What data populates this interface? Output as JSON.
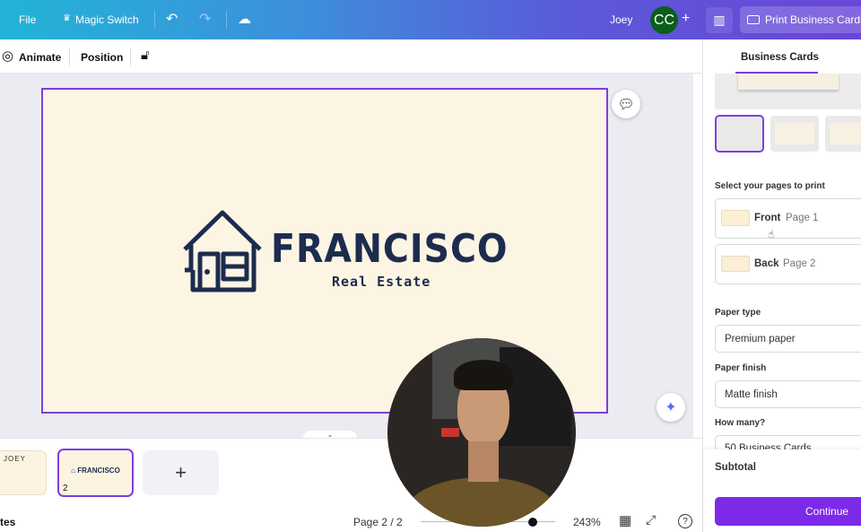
{
  "topbar": {
    "file": "File",
    "magic_switch": "Magic Switch",
    "user": "Joey",
    "avatar_initials": "CC",
    "print_button": "Print Business Cards"
  },
  "toolbar": {
    "animate": "Animate",
    "position": "Position"
  },
  "design": {
    "brand": "FRANCISCO",
    "tagline": "Real Estate"
  },
  "pages": {
    "thumb1_text": "JOEY",
    "thumb2_text": "FRANCISCO",
    "thumb2_number": "2",
    "add_page": "+"
  },
  "bottombar": {
    "notes": "tes",
    "page_indicator": "Page 2 / 2",
    "zoom": "243%",
    "zoom_level_percent": 243
  },
  "panel": {
    "tab": "Business Cards",
    "select_pages_label": "Select your pages to print",
    "pages": [
      {
        "side": "Front",
        "page": "Page 1"
      },
      {
        "side": "Back",
        "page": "Page 2"
      }
    ],
    "paper_type_label": "Paper type",
    "paper_type": "Premium paper",
    "paper_finish_label": "Paper finish",
    "paper_finish": "Matte finish",
    "quantity_label": "How many?",
    "quantity": "50 Business Cards",
    "subtotal_label": "Subtotal",
    "continue": "Continue"
  },
  "colors": {
    "accent": "#7d3ee0",
    "brand_navy": "#1d2c4e",
    "card_bg": "#fdf5e4",
    "avatar": "#0b5e1a"
  }
}
